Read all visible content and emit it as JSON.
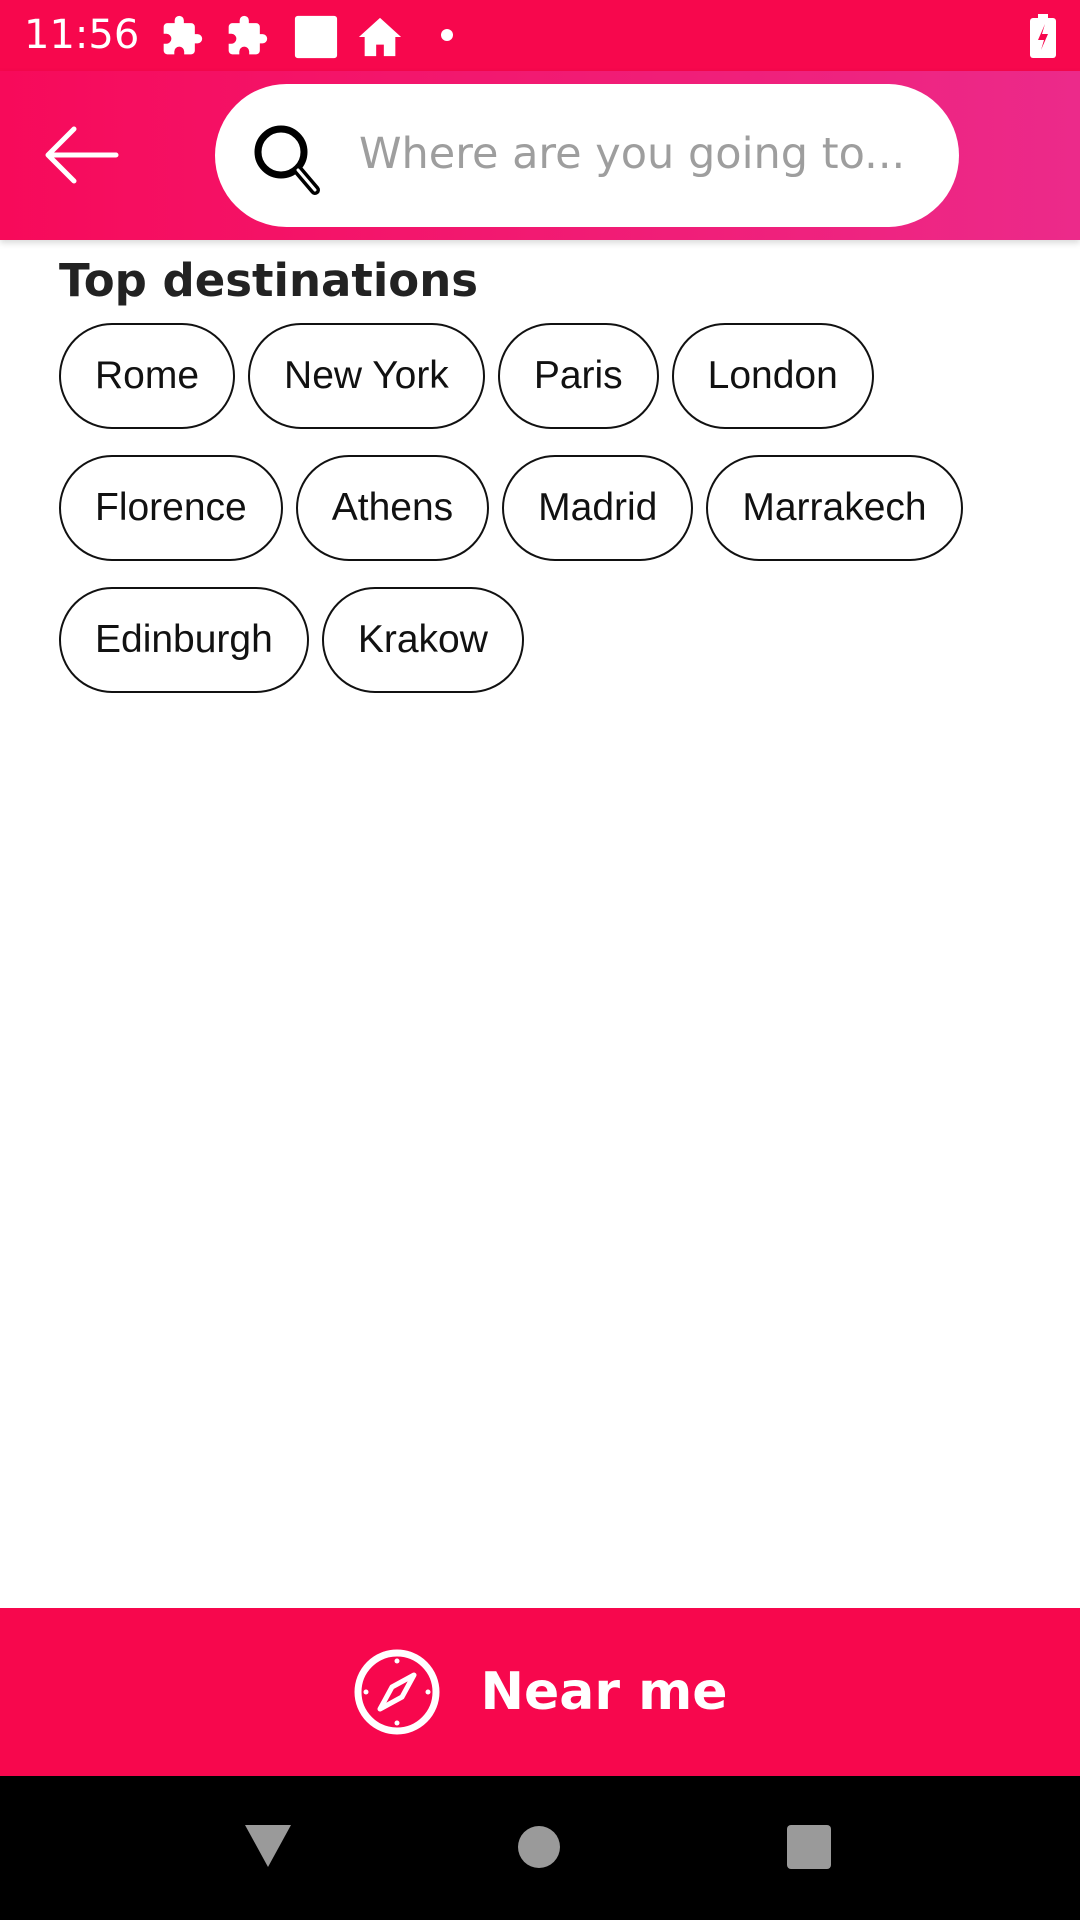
{
  "status_bar": {
    "time": "11:56",
    "icons": [
      "puzzle-icon",
      "puzzle-icon",
      "square-icon",
      "home-icon",
      "dot-icon",
      "battery-charging-icon"
    ]
  },
  "header": {
    "back_icon": "arrow-left-icon",
    "search": {
      "icon": "search-icon",
      "value": "",
      "placeholder": "Where are you going to..."
    }
  },
  "top_destinations": {
    "title": "Top destinations",
    "chips": [
      "Rome",
      "New York",
      "Paris",
      "London",
      "Florence",
      "Athens",
      "Madrid",
      "Marrakech",
      "Edinburgh",
      "Krakow"
    ]
  },
  "near_me": {
    "label": "Near me",
    "icon": "compass-icon"
  },
  "colors": {
    "accent": "#F7074D",
    "header_gradient_end": "#EC2A8A"
  },
  "nav_bar": {
    "icons": [
      "back-triangle-icon",
      "home-circle-icon",
      "recents-square-icon"
    ]
  }
}
